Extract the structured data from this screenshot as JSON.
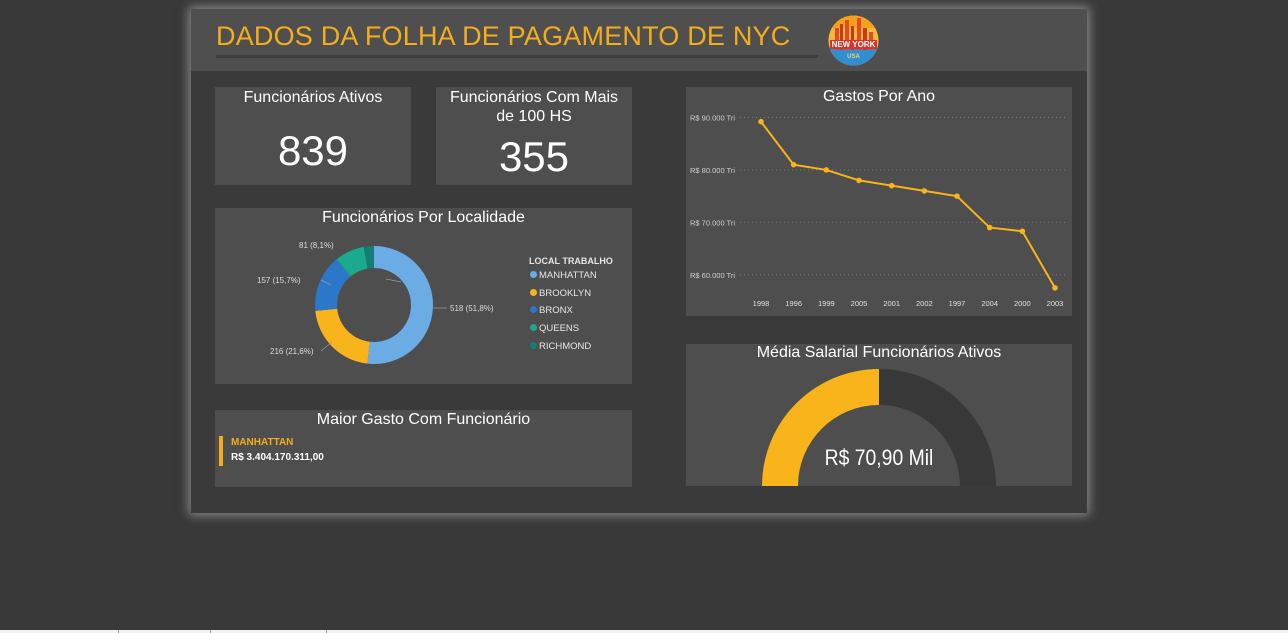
{
  "dashboard": {
    "title": "DADOS DA FOLHA DE PAGAMENTO DE NYC",
    "logo_text": "NEW YORK",
    "logo_subtext": "USA"
  },
  "kpi_active": {
    "title": "Funcionários Ativos",
    "value": "839"
  },
  "kpi_100hs": {
    "title_line1": "Funcionários Com Mais",
    "title_line2": "de 100 HS",
    "value": "355"
  },
  "location": {
    "title": "Funcionários Por Localidade",
    "legend_title": "LOCAL TRABALHO",
    "labels": {
      "manhattan": "518 (51,8%)",
      "brooklyn": "216 (21,6%)",
      "bronx": "157 (15,7%)",
      "queens": "81 (8,1%)"
    }
  },
  "max_spend": {
    "title": "Maior Gasto Com Funcionário",
    "location": "MANHATTAN",
    "value": "R$ 3.404.170.311,00"
  },
  "gauge": {
    "title": "Média Salarial Funcionários Ativos",
    "value_label": "R$ 70,90 Mil",
    "fraction": 0.5
  },
  "colors": {
    "accent": "#f4ad1c",
    "manhattan": "#6cace4",
    "brooklyn": "#f9b41b",
    "bronx": "#2b78c8",
    "queens": "#1aaa8f",
    "richmond": "#177d72"
  },
  "chart_data": [
    {
      "type": "pie",
      "donut": true,
      "title": "Funcionários Por Localidade",
      "legend_title": "LOCAL TRABALHO",
      "legend_position": "right",
      "categories": [
        "MANHATTAN",
        "BROOKLYN",
        "BRONX",
        "QUEENS",
        "RICHMOND"
      ],
      "values": [
        518,
        216,
        157,
        81,
        28
      ],
      "colors": [
        "#6cace4",
        "#f9b41b",
        "#2b78c8",
        "#1aaa8f",
        "#177d72"
      ]
    },
    {
      "type": "line",
      "title": "Gastos Por Ano",
      "categories": [
        "1998",
        "1996",
        "1999",
        "2005",
        "2001",
        "2002",
        "1997",
        "2004",
        "2000",
        "2003"
      ],
      "values": [
        89.2,
        81.0,
        80.0,
        78.0,
        77.0,
        76.0,
        75.0,
        69.0,
        68.3,
        57.5
      ],
      "unit": "Tri",
      "ylim": [
        55,
        92
      ],
      "y_ticks": [
        60,
        70,
        80,
        90
      ],
      "y_tick_labels": [
        "R$ 60.000 Tri",
        "R$ 70.000 Tri",
        "R$ 80.000 Tri",
        "R$ 90.000 Tri"
      ],
      "grid": true,
      "color": "#f9b41b"
    }
  ]
}
